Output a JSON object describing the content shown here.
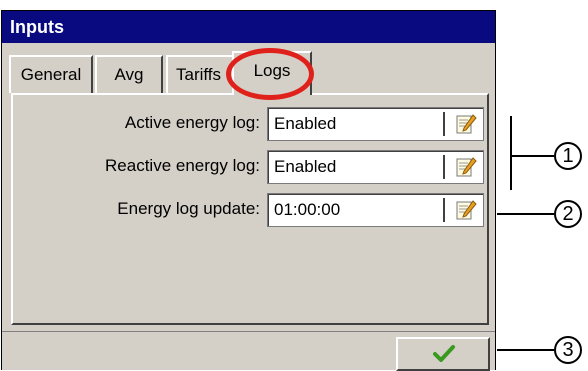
{
  "window": {
    "title": "Inputs"
  },
  "tabs": [
    {
      "label": "General"
    },
    {
      "label": "Avg"
    },
    {
      "label": "Tariffs"
    },
    {
      "label": "Logs",
      "active": true
    }
  ],
  "fields": [
    {
      "label": "Active energy log:",
      "value": "Enabled",
      "icon": "edit-icon"
    },
    {
      "label": "Reactive energy log:",
      "value": "Enabled",
      "icon": "edit-icon"
    },
    {
      "label": "Energy log update:",
      "value": "01:00:00",
      "icon": "edit-icon"
    }
  ],
  "footer": {
    "ok_icon": "checkmark-icon"
  },
  "callouts": [
    "1",
    "2",
    "3"
  ],
  "colors": {
    "titlebar": "#0a0a80",
    "highlight": "#e0201a",
    "check": "#3a9a20"
  }
}
